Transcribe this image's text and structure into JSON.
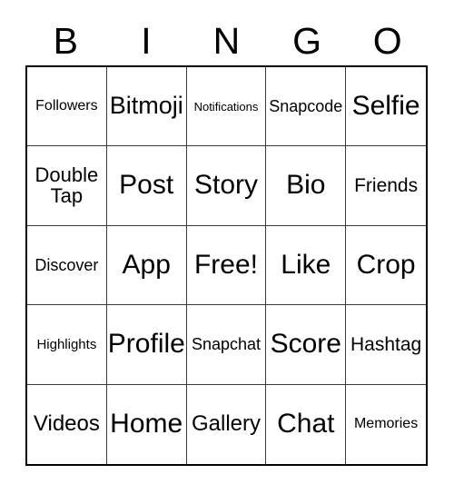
{
  "card": {
    "title": "BINGO",
    "header_letters": [
      "B",
      "I",
      "N",
      "G",
      "O"
    ],
    "grid_size": "5x5",
    "colors": {
      "background": "#ffffff",
      "text": "#000000",
      "outer_border": "#000000",
      "inner_border": "#3a3a3a"
    },
    "rows": [
      [
        {
          "text": "Followers",
          "size": "sm"
        },
        {
          "text": "Bitmoji",
          "size": "xl"
        },
        {
          "text": "Notifications",
          "size": "xs"
        },
        {
          "text": "Snapcode",
          "size": "m"
        },
        {
          "text": "Selfie",
          "size": "xxl"
        }
      ],
      [
        {
          "text": "Double\nTap",
          "size": "wrap"
        },
        {
          "text": "Post",
          "size": "xxl"
        },
        {
          "text": "Story",
          "size": "xxl"
        },
        {
          "text": "Bio",
          "size": "xxl"
        },
        {
          "text": "Friends",
          "size": "ml"
        }
      ],
      [
        {
          "text": "Discover",
          "size": "m"
        },
        {
          "text": "App",
          "size": "xxl"
        },
        {
          "text": "Free!",
          "size": "xxl"
        },
        {
          "text": "Like",
          "size": "xxl"
        },
        {
          "text": "Crop",
          "size": "xxl"
        }
      ],
      [
        {
          "text": "Highlights",
          "size": "s"
        },
        {
          "text": "Profile",
          "size": "xxl"
        },
        {
          "text": "Snapchat",
          "size": "m"
        },
        {
          "text": "Score",
          "size": "xxl"
        },
        {
          "text": "Hashtag",
          "size": "ml"
        }
      ],
      [
        {
          "text": "Videos",
          "size": "l"
        },
        {
          "text": "Home",
          "size": "xxl"
        },
        {
          "text": "Gallery",
          "size": "l"
        },
        {
          "text": "Chat",
          "size": "xxl"
        },
        {
          "text": "Memories",
          "size": "sm"
        }
      ]
    ]
  }
}
